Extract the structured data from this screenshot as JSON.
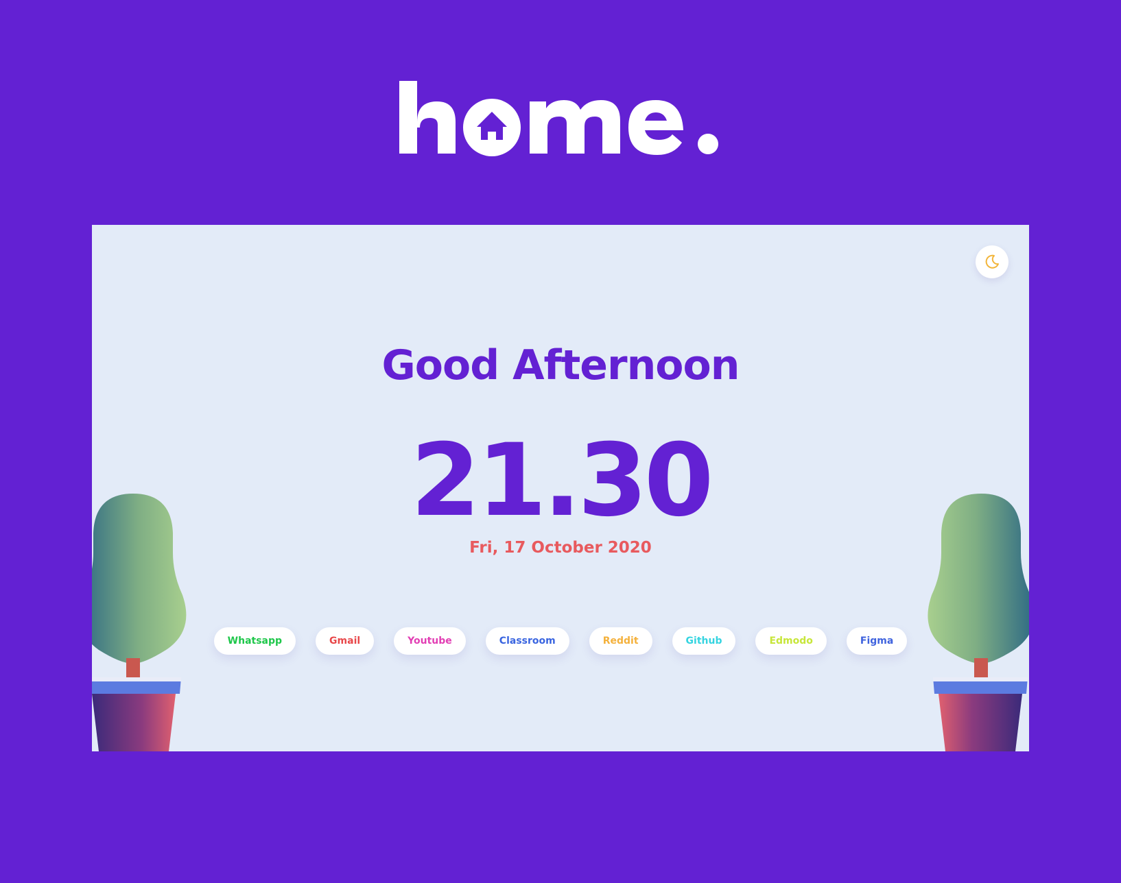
{
  "logo": {
    "text": "hme.",
    "icon": "house-icon"
  },
  "theme_toggle": {
    "icon": "moon-icon",
    "color": "#f2b53a"
  },
  "greeting": "Good Afternoon",
  "clock": "21.30",
  "date": "Fri, 17 October 2020",
  "links": [
    {
      "label": "Whatsapp",
      "color": "#1ec74a"
    },
    {
      "label": "Gmail",
      "color": "#e8484a"
    },
    {
      "label": "Youtube",
      "color": "#e23fb4"
    },
    {
      "label": "Classroom",
      "color": "#3a65e0"
    },
    {
      "label": "Reddit",
      "color": "#f4b13c"
    },
    {
      "label": "Github",
      "color": "#35d4e0"
    },
    {
      "label": "Edmodo",
      "color": "#c7e63a"
    },
    {
      "label": "Figma",
      "color": "#3f63de"
    }
  ],
  "colors": {
    "background": "#6321d3",
    "card": "#e3ebf8",
    "accent": "#6321d3",
    "date": "#e85a5e"
  }
}
